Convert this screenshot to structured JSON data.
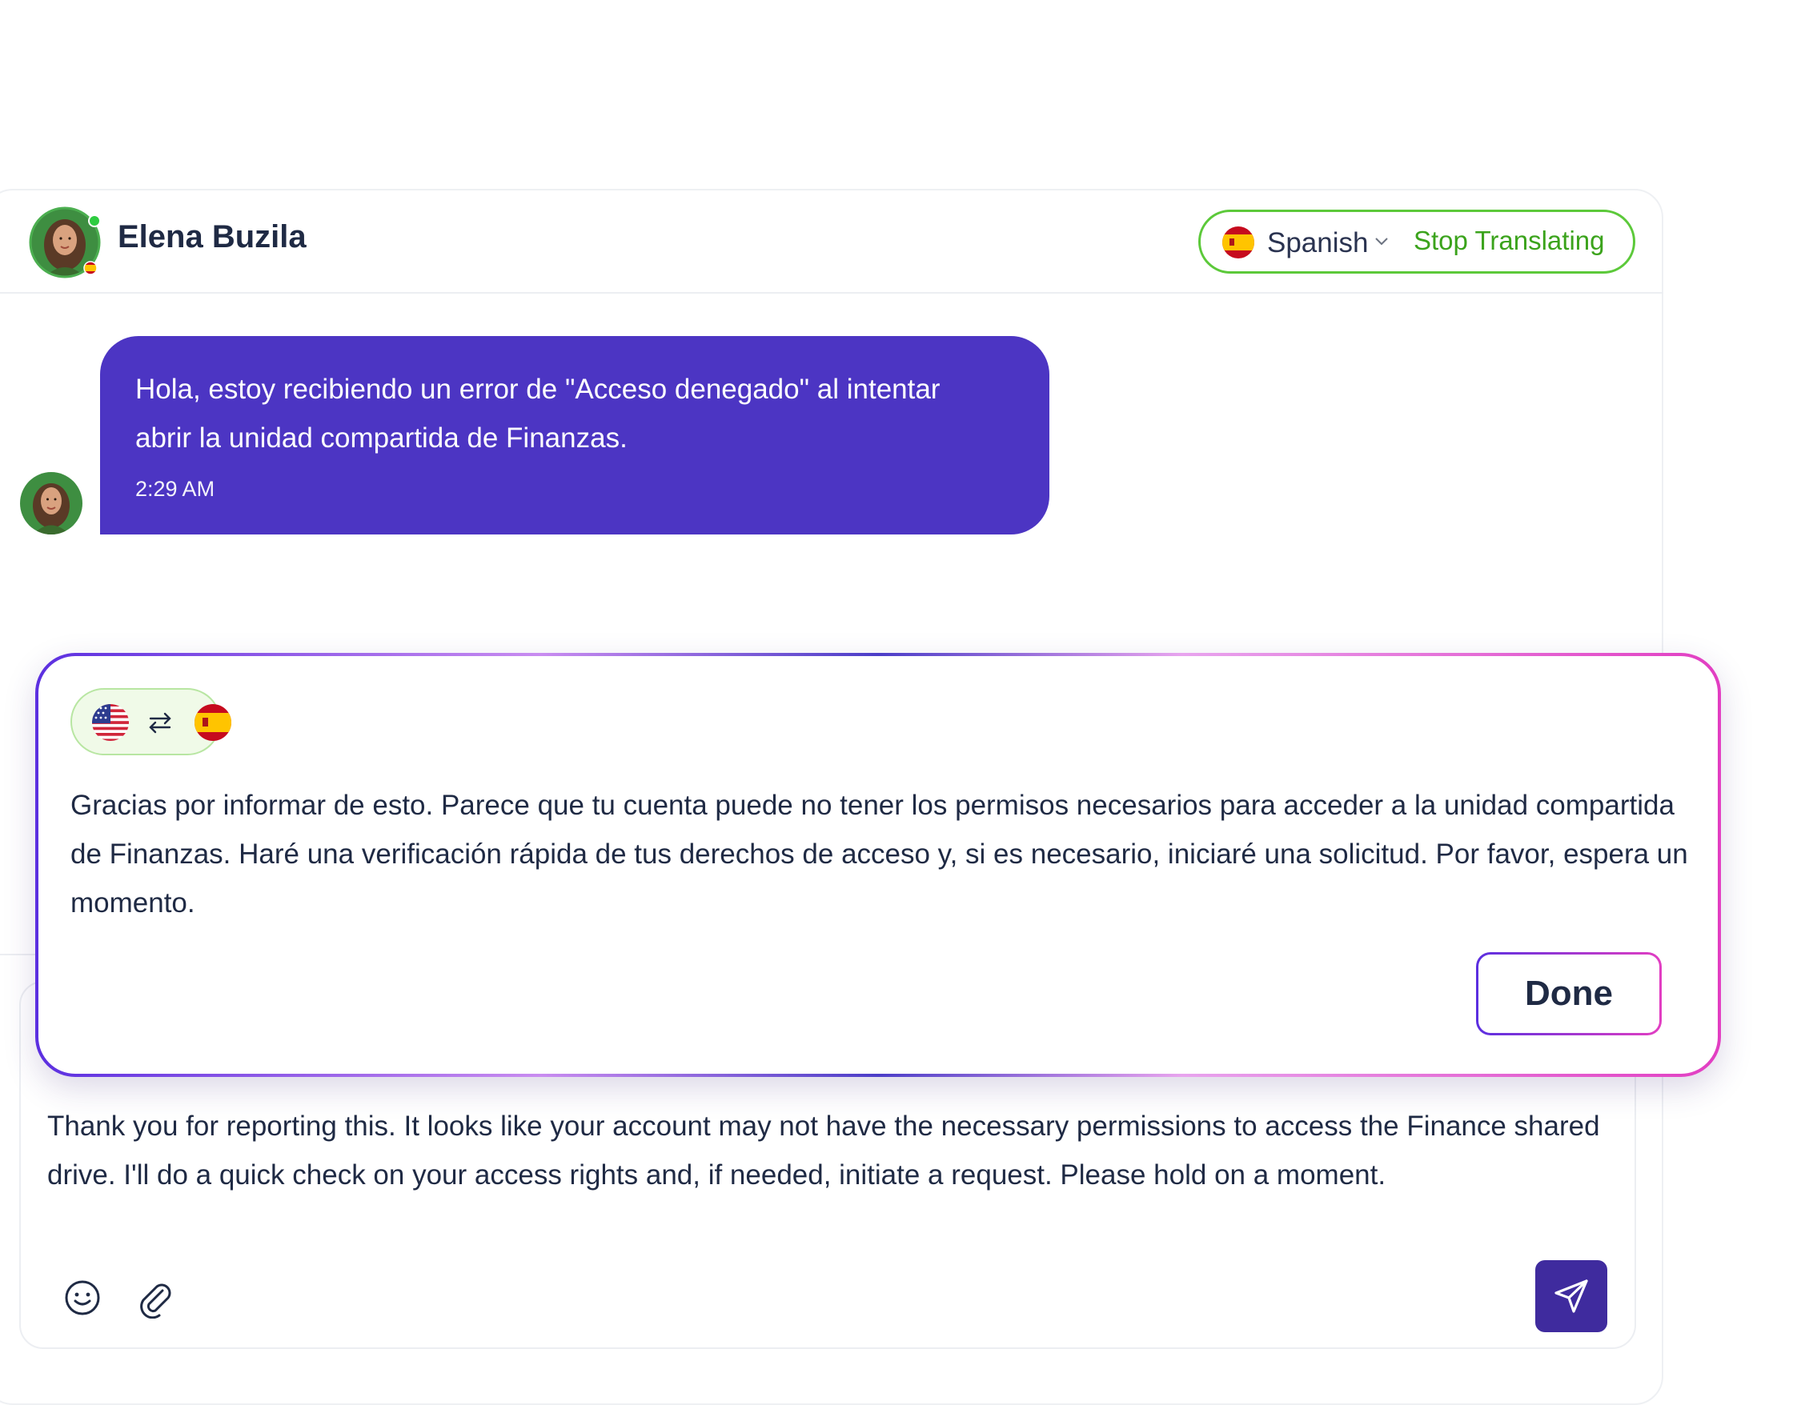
{
  "header": {
    "contact_name": "Elena Buzila",
    "language": "Spanish",
    "stop_label": "Stop Translating"
  },
  "message": {
    "text": "Hola, estoy recibiendo un error de \"Acceso denegado\" al intentar abrir la unidad compartida de Finanzas.",
    "time": "2:29 AM",
    "bubble_color": "#4c35c3"
  },
  "translation_card": {
    "translated_text": "Gracias por informar de esto. Parece que tu cuenta puede no tener los permisos necesarios para acceder a la unidad compartida de Finanzas. Haré una verificación rápida de tus derechos de acceso y, si es necesario, iniciaré una solicitud. Por favor, espera un momento.",
    "done_label": "Done",
    "source_flag": "us-flag-icon",
    "target_flag": "es-flag-icon"
  },
  "composer": {
    "text": "Thank you for reporting this. It looks like your account may not have the necessary permissions to access the Finance shared drive. I'll do a quick check on your access rights and, if needed, initiate a request. Please hold on a moment."
  },
  "colors": {
    "accent": "#4c35c3",
    "success": "#3ba31c",
    "send_button": "#3f2b9e"
  }
}
